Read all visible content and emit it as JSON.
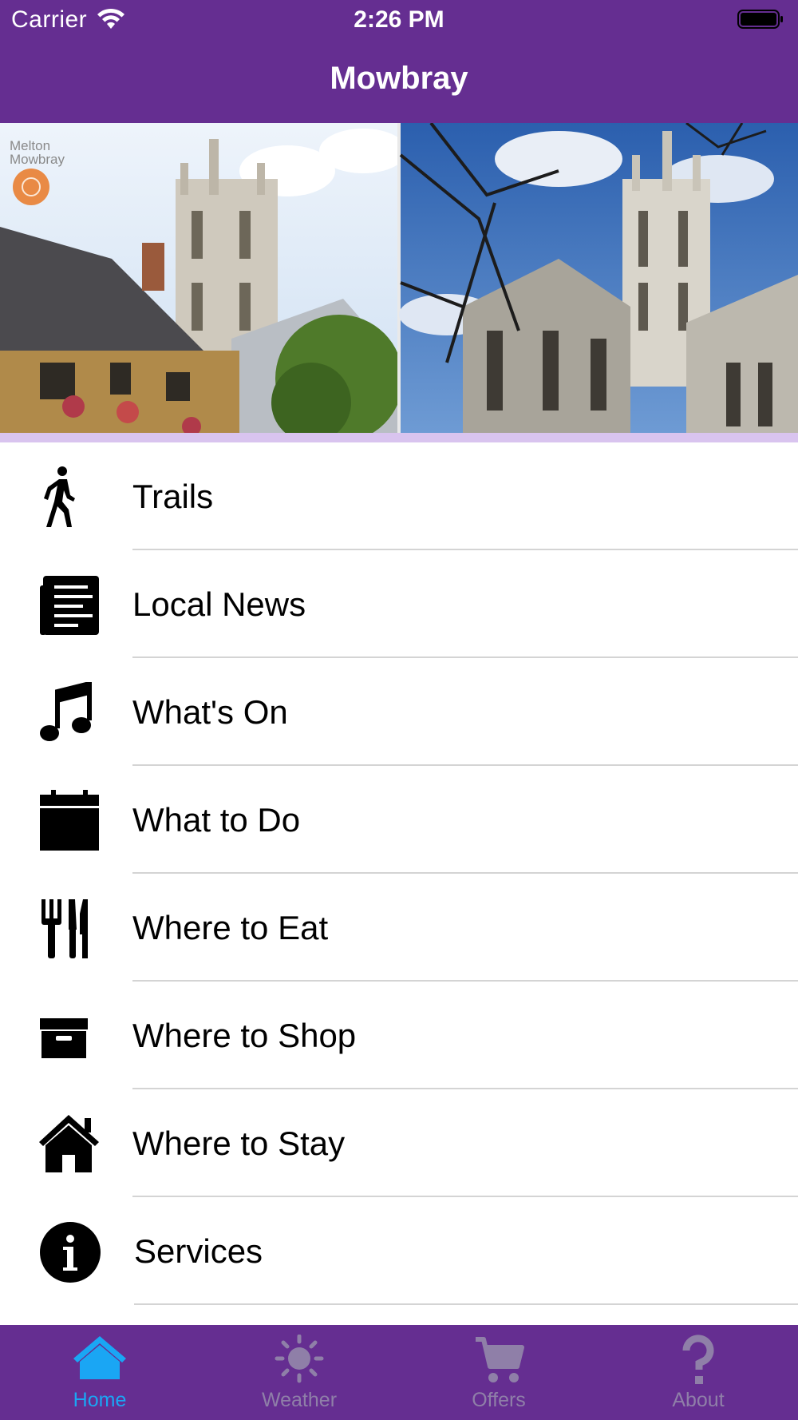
{
  "status_bar": {
    "carrier": "Carrier",
    "time": "2:26 PM",
    "wifi_icon": "wifi-icon",
    "battery_icon": "battery-icon"
  },
  "nav": {
    "title": "Mowbray"
  },
  "banner": {
    "logo_text_line1": "Melton",
    "logo_text_line2": "Mowbray"
  },
  "menu": {
    "items": [
      {
        "label": "Trails",
        "icon": "walking-person-icon"
      },
      {
        "label": "Local News",
        "icon": "newspaper-icon"
      },
      {
        "label": "What's On",
        "icon": "music-note-icon"
      },
      {
        "label": "What to Do",
        "icon": "calendar-icon"
      },
      {
        "label": "Where to Eat",
        "icon": "cutlery-icon"
      },
      {
        "label": "Where to Shop",
        "icon": "archive-box-icon"
      },
      {
        "label": "Where to Stay",
        "icon": "house-icon"
      },
      {
        "label": "Services",
        "icon": "info-circle-icon"
      }
    ]
  },
  "tabs": {
    "active": "Home",
    "items": [
      {
        "label": "Home",
        "icon": "home-icon"
      },
      {
        "label": "Weather",
        "icon": "sun-icon"
      },
      {
        "label": "Offers",
        "icon": "shopping-cart-icon"
      },
      {
        "label": "About",
        "icon": "question-mark-icon"
      }
    ]
  },
  "colors": {
    "brand_purple": "#652e91",
    "banner_strip": "#d9c4ef",
    "tab_active": "#1aa6f4",
    "tab_inactive": "#8f7fa8",
    "separator": "#d4d4d4"
  }
}
